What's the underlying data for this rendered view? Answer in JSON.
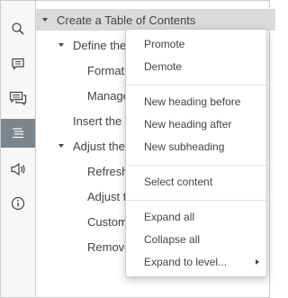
{
  "sidebar": {
    "buttons": [
      {
        "icon": "search-icon"
      },
      {
        "icon": "comment-icon"
      },
      {
        "icon": "chat-icon"
      },
      {
        "icon": "navigation-icon",
        "active": true
      },
      {
        "icon": "feedback-icon"
      },
      {
        "icon": "info-icon"
      }
    ]
  },
  "tree": {
    "items": [
      {
        "label": "Create a Table of Contents",
        "level": 0,
        "expanded": true,
        "selected": true
      },
      {
        "label": "Define the",
        "level": 1,
        "expanded": true
      },
      {
        "label": "Format h",
        "level": 2
      },
      {
        "label": "Manage",
        "level": 2
      },
      {
        "label": "Insert the T",
        "level": 1
      },
      {
        "label": "Adjust the c",
        "level": 1,
        "expanded": true
      },
      {
        "label": "Refresh",
        "level": 2
      },
      {
        "label": "Adjust th",
        "level": 2
      },
      {
        "label": "Customi",
        "level": 2
      },
      {
        "label": "Remove",
        "level": 2
      }
    ]
  },
  "menu": {
    "promote": "Promote",
    "demote": "Demote",
    "new_heading_before": "New heading before",
    "new_heading_after": "New heading after",
    "new_subheading": "New subheading",
    "select_content": "Select content",
    "expand_all": "Expand all",
    "collapse_all": "Collapse all",
    "expand_to_level": "Expand to level..."
  },
  "colors": {
    "active_button": "#7d858c",
    "selected_row": "#dadada",
    "border": "#cbcbcb"
  }
}
